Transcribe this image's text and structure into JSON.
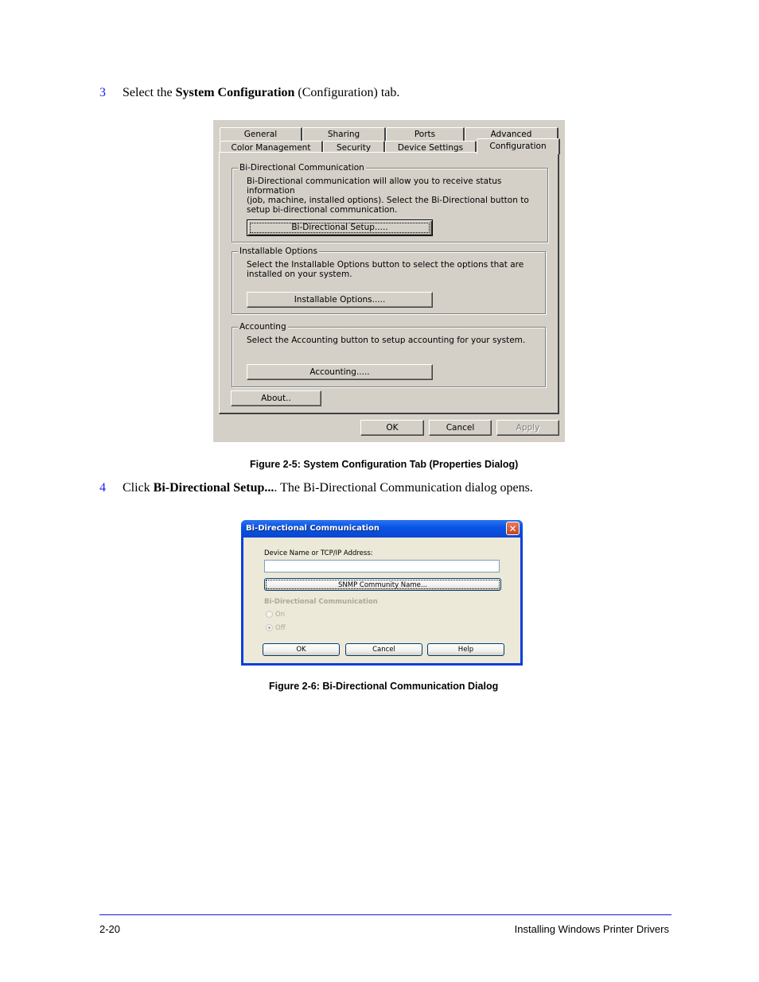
{
  "steps": [
    {
      "number": "3",
      "pre": "Select the ",
      "bold": "System Configuration",
      "post": " (Configuration) tab."
    },
    {
      "number": "4",
      "pre": "Click ",
      "bold": "Bi-Directional Setup...",
      "post": ". The Bi-Directional Communication dialog opens."
    }
  ],
  "figure1": {
    "caption": "Figure 2-5:  System Configuration Tab (Properties Dialog)",
    "tabs_row1": [
      "General",
      "Sharing",
      "Ports",
      "Advanced"
    ],
    "tabs_row2": [
      "Color Management",
      "Security",
      "Device Settings",
      "Configuration"
    ],
    "active_tab": "Configuration",
    "groups": {
      "bidi": {
        "title": "Bi-Directional Communication",
        "lines": [
          "Bi-Directional communication will allow you to receive status information",
          "(job, machine, installed options). Select the Bi-Directional button to",
          "setup bi-directional communication."
        ],
        "button": "Bi-Directional Setup....."
      },
      "options": {
        "title": "Installable Options",
        "lines": [
          "Select the Installable Options button to select the options that are",
          "installed on your system."
        ],
        "button": "Installable Options....."
      },
      "accounting": {
        "title": "Accounting",
        "lines": [
          "Select the Accounting button to setup accounting for your system."
        ],
        "button": "Accounting....."
      }
    },
    "about_button": "About..",
    "ok_button": "OK",
    "cancel_button": "Cancel",
    "apply_button": "Apply"
  },
  "figure2": {
    "caption": "Figure 2-6:  Bi-Directional Communication Dialog",
    "title": "Bi-Directional Communication",
    "close_glyph": "✕",
    "device_label": "Device Name or TCP/IP Address:",
    "device_value": "",
    "snmp_button": "SNMP Community Name...",
    "bidi_label": "Bi-Directional Communication",
    "radio_on": "On",
    "radio_off": "Off",
    "selected": "Off",
    "ok_button": "OK",
    "cancel_button": "Cancel",
    "help_button": "Help"
  },
  "footer": {
    "page_number": "2-20",
    "section_title": "Installing Windows Printer Drivers"
  }
}
